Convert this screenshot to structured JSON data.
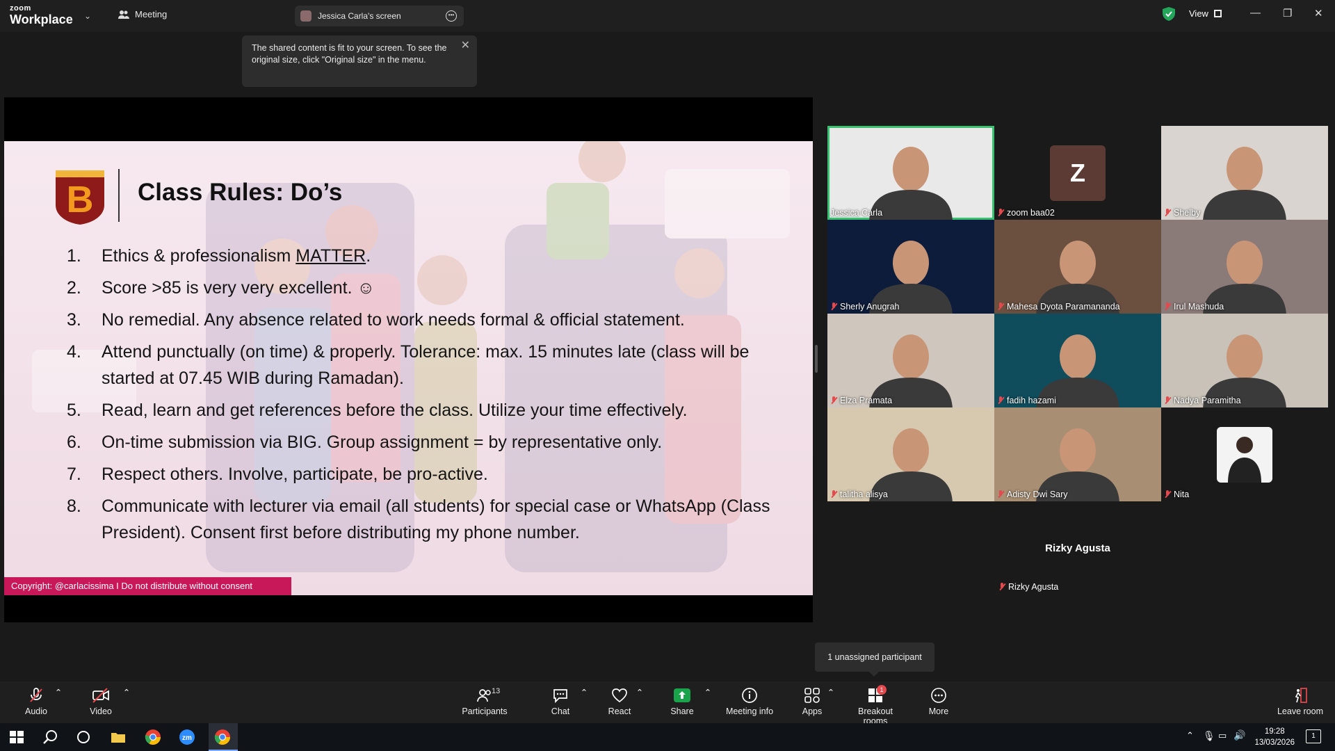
{
  "titlebar": {
    "brand_top": "zoom",
    "brand_bottom": "Workplace",
    "meeting_tab": "Meeting",
    "screen_tab": "Jessica Carla's screen",
    "view_label": "View"
  },
  "tooltip": {
    "text": "The shared content is fit to your screen. To see the original size, click \"Original size\" in the menu."
  },
  "slide": {
    "logo_letter": "B",
    "title": "Class Rules: Do’s",
    "rules": [
      {
        "num": "1.",
        "pre": "Ethics & professionalism ",
        "underlined": "MATTER",
        "post": "."
      },
      {
        "num": "2.",
        "text": "Score >85 is very very excellent. ☺"
      },
      {
        "num": "3.",
        "text": "No remedial. Any absence related to work needs formal & official statement."
      },
      {
        "num": "4.",
        "text": "Attend punctually (on time) & properly. Tolerance: max. 15 minutes late (class will be started at 07.45 WIB during Ramadan)."
      },
      {
        "num": "5.",
        "text": "Read, learn and get references before the class. Utilize your time effectively."
      },
      {
        "num": "6.",
        "text": "On-time submission via BIG. Group assignment = by representative only."
      },
      {
        "num": "7.",
        "text": "Respect others. Involve, participate, be pro-active."
      },
      {
        "num": "8.",
        "text": "Communicate with lecturer via email (all students) for special case or WhatsApp (Class President). Consent first before distributing my phone number."
      }
    ],
    "copyright": "Copyright: @carlacissima I Do not distribute without consent"
  },
  "gallery": {
    "participants": [
      {
        "name": "Jessica Carla",
        "muted": false,
        "bg": "#e9e9e9"
      },
      {
        "name": "zoom baa02",
        "muted": true,
        "bg": "#1a1a1a",
        "initial": "Z"
      },
      {
        "name": "Shelby",
        "muted": true,
        "bg": "#d9d4cf"
      },
      {
        "name": "Sherly Anugrah",
        "muted": true,
        "bg": "#0d1c3a"
      },
      {
        "name": "Mahesa Dyota Paramananda",
        "muted": true,
        "bg": "#6b5040"
      },
      {
        "name": "Irul Mashuda",
        "muted": true,
        "bg": "#8a7a78"
      },
      {
        "name": "Elza Pramata",
        "muted": true,
        "bg": "#cfc6bd"
      },
      {
        "name": "fadih hazami",
        "muted": true,
        "bg": "#0f4d5c"
      },
      {
        "name": "Nadya Paramitha",
        "muted": true,
        "bg": "#c8c2b8"
      },
      {
        "name": "talitha alisya",
        "muted": true,
        "bg": "#d6c9b0"
      },
      {
        "name": "Adisty Dwi Sary",
        "muted": true,
        "bg": "#a88e72"
      },
      {
        "name": "Nita",
        "muted": true,
        "bg": "#1a1a1a"
      }
    ],
    "rizky_big": "Rizky Agusta",
    "rizky_small": "Rizky Agusta"
  },
  "unassigned": "1 unassigned participant",
  "toolbar": {
    "audio": "Audio",
    "video": "Video",
    "participants": "Participants",
    "participants_count": "13",
    "chat": "Chat",
    "react": "React",
    "share": "Share",
    "meeting_info": "Meeting info",
    "apps": "Apps",
    "breakout_rooms": "Breakout rooms",
    "breakout_badge": "1",
    "more": "More",
    "leave": "Leave room"
  },
  "taskbar": {
    "time": "19:28",
    "date": "13/03/2026",
    "notification_count": "1"
  },
  "colors": {
    "active_speaker": "#36c26f",
    "muted_red": "#e5484d",
    "copyright_bar": "#c8185a",
    "share_green": "#1aa34a"
  }
}
